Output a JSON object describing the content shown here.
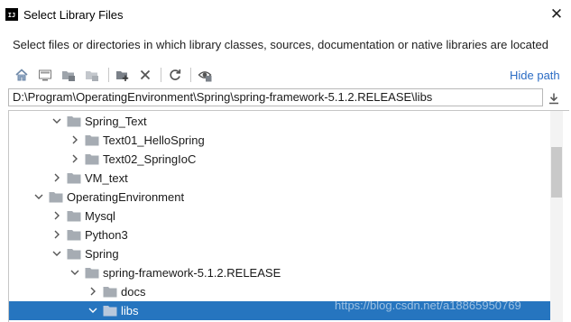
{
  "window": {
    "app_icon_text": "IJ",
    "title": "Select Library Files",
    "close_glyph": "✕"
  },
  "description": "Select files or directories in which library classes, sources, documentation or native libraries are located",
  "toolbar": {
    "buttons": [
      {
        "icon": "home-icon"
      },
      {
        "icon": "desktop-icon"
      },
      {
        "icon": "project-folder-icon"
      },
      {
        "icon": "module-folder-icon"
      },
      {
        "icon": "new-folder-icon"
      },
      {
        "icon": "delete-icon"
      },
      {
        "icon": "refresh-icon"
      },
      {
        "icon": "show-hidden-icon"
      }
    ],
    "hide_path_label": "Hide path"
  },
  "path": {
    "value": "D:\\Program\\OperatingEnvironment\\Spring\\spring-framework-5.1.2.RELEASE\\libs",
    "download_icon": "download-icon"
  },
  "tree": {
    "nodes": [
      {
        "label": "Spring_Text",
        "level": 3,
        "expanded": true,
        "selected": false
      },
      {
        "label": "Text01_HelloSpring",
        "level": 4,
        "expanded": false,
        "selected": false
      },
      {
        "label": "Text02_SpringIoC",
        "level": 4,
        "expanded": false,
        "selected": false
      },
      {
        "label": "VM_text",
        "level": 3,
        "expanded": false,
        "selected": false
      },
      {
        "label": "OperatingEnvironment",
        "level": 2,
        "expanded": true,
        "selected": false
      },
      {
        "label": "Mysql",
        "level": 3,
        "expanded": false,
        "selected": false
      },
      {
        "label": "Python3",
        "level": 3,
        "expanded": false,
        "selected": false
      },
      {
        "label": "Spring",
        "level": 3,
        "expanded": true,
        "selected": false
      },
      {
        "label": "spring-framework-5.1.2.RELEASE",
        "level": 4,
        "expanded": true,
        "selected": false
      },
      {
        "label": "docs",
        "level": 5,
        "expanded": false,
        "selected": false
      },
      {
        "label": "libs",
        "level": 5,
        "expanded": true,
        "selected": true
      }
    ]
  },
  "watermark": "https://blog.csdn.net/a18865950769",
  "colors": {
    "selection": "#2675bf",
    "link": "#2b6cc4",
    "folder": "#a6acb3"
  }
}
